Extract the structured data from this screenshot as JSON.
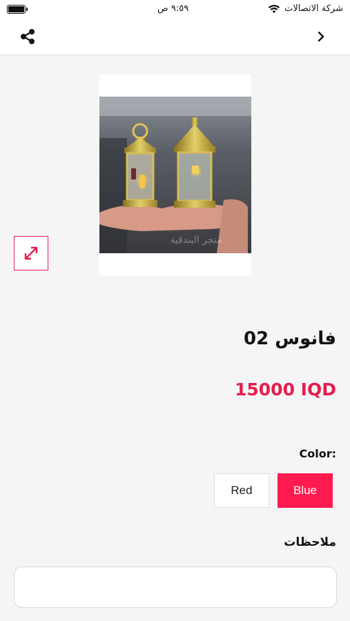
{
  "status_bar": {
    "carrier": "شركة الاتصالات",
    "time": "٩:٥٩ ص",
    "icons": [
      "wifi-icon",
      "battery-icon"
    ]
  },
  "nav": {
    "share_icon": "share-icon",
    "back_icon": "chevron-icon"
  },
  "product": {
    "image_alt": "lanterns-photo",
    "expand_icon": "expand-icon",
    "title": "فانوس 02",
    "price": "15000 IQD"
  },
  "options": {
    "color_label": "Color:",
    "colors": [
      {
        "label": "Blue",
        "selected": true
      },
      {
        "label": "Red",
        "selected": false
      }
    ]
  },
  "notes": {
    "label": "ملاحظات",
    "value": "",
    "placeholder": ""
  },
  "colors": {
    "accent": "#ff1a4f",
    "price": "#e61e4d",
    "background": "#f5f5f5"
  }
}
